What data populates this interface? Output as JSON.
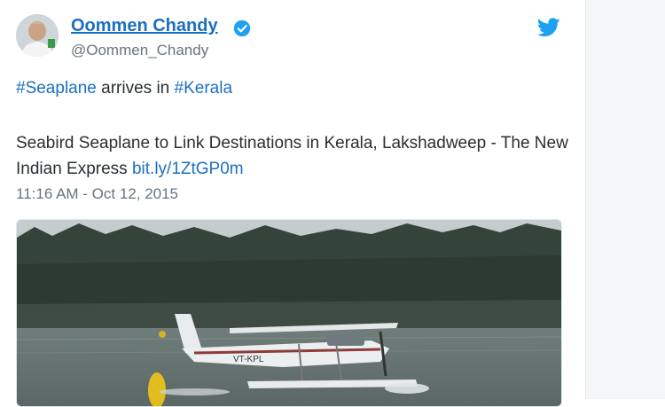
{
  "tweet": {
    "author_name": "Oommen Chandy",
    "handle": "@Oommen_Chandy",
    "hashtag_1": "#Seaplane",
    "text_between": "arrives in",
    "hashtag_2": "#Kerala",
    "body_text": "Seabird Seaplane to Link Destinations in Kerala, Lakshadweep - The New Indian Express",
    "link": "bit.ly/1ZtGP0m",
    "timestamp": "11:16 AM - Oct 12, 2015",
    "aircraft_registration": "VT-KPL"
  },
  "icons": {
    "verified": "verified-badge-icon",
    "brand": "twitter-bird-icon"
  },
  "colors": {
    "link": "#1b6fc2",
    "text": "#292f33",
    "muted": "#66757f",
    "verified": "#1da1f2",
    "twitter": "#1da1f2"
  }
}
